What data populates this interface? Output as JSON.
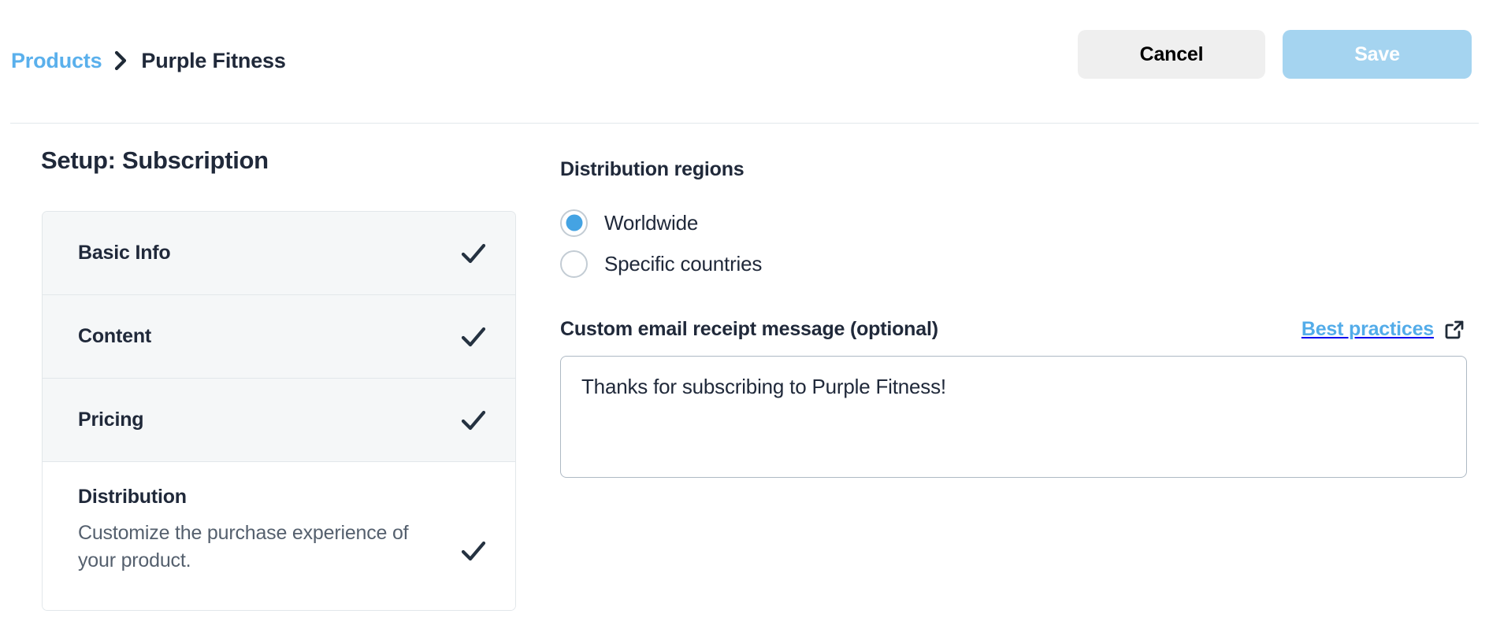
{
  "header": {
    "breadcrumb": {
      "parent": "Products",
      "separator_icon": "chevron-right-icon",
      "current": "Purple Fitness"
    },
    "actions": {
      "cancel_label": "Cancel",
      "save_label": "Save"
    }
  },
  "sidebar": {
    "title": "Setup: Subscription",
    "steps": [
      {
        "label": "Basic Info",
        "description": "",
        "completed": true,
        "active": false,
        "check_icon": "check-icon"
      },
      {
        "label": "Content",
        "description": "",
        "completed": true,
        "active": false,
        "check_icon": "check-icon"
      },
      {
        "label": "Pricing",
        "description": "",
        "completed": true,
        "active": false,
        "check_icon": "check-icon"
      },
      {
        "label": "Distribution",
        "description": "Customize the purchase experience of your product.",
        "completed": true,
        "active": true,
        "check_icon": "check-icon"
      }
    ]
  },
  "main": {
    "regions": {
      "label": "Distribution regions",
      "options": [
        {
          "label": "Worldwide",
          "selected": true
        },
        {
          "label": "Specific countries",
          "selected": false
        }
      ]
    },
    "email": {
      "label": "Custom email receipt message (optional)",
      "best_practices_label": "Best practices",
      "best_practices_icon": "external-link-icon",
      "value": "Thanks for subscribing to Purple Fitness!",
      "placeholder": ""
    }
  },
  "colors": {
    "link_blue": "#53ace9",
    "accent_blue": "#44a3e3",
    "save_disabled_blue": "#a5d4f0",
    "cancel_gray": "#efefef",
    "text_dark": "#20293a",
    "muted_text": "#55606e",
    "border": "#e2e7ea",
    "step_bg": "#f5f7f8"
  }
}
